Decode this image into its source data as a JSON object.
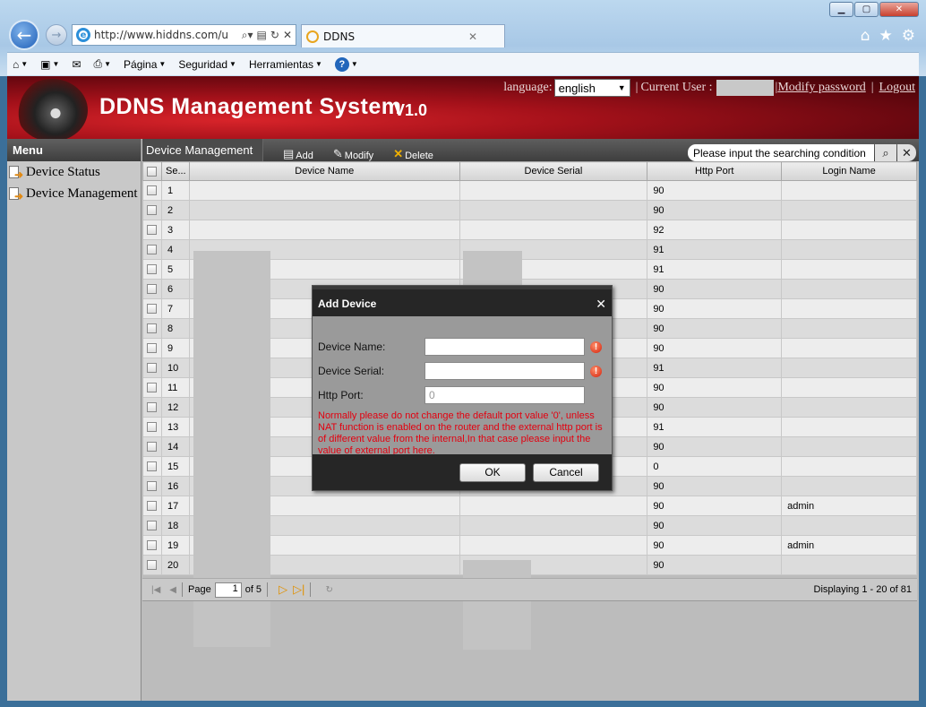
{
  "browser": {
    "url": "http://www.hiddns.com/u",
    "tab_title": "DDNS",
    "menu": [
      "Página",
      "Seguridad",
      "Herramientas"
    ]
  },
  "banner": {
    "title": "DDNS Management System",
    "version": "V1.0",
    "language_label": "language:",
    "language_value": "english",
    "current_user_label": "Current User :",
    "modify_password": "Modify password",
    "logout": "Logout"
  },
  "sidebar": {
    "header": "Menu",
    "items": [
      {
        "label": "Device Status"
      },
      {
        "label": "Device Management"
      }
    ]
  },
  "toolbar": {
    "title": "Device Management",
    "add": "Add",
    "modify": "Modify",
    "delete": "Delete",
    "search_placeholder": "Please input the searching condition"
  },
  "grid": {
    "columns": [
      "Se...",
      "Device Name",
      "Device Serial",
      "Http Port",
      "Login Name"
    ],
    "rows": [
      {
        "seq": "1",
        "port": "90",
        "login": ""
      },
      {
        "seq": "2",
        "port": "90",
        "login": ""
      },
      {
        "seq": "3",
        "port": "92",
        "login": ""
      },
      {
        "seq": "4",
        "port": "91",
        "login": ""
      },
      {
        "seq": "5",
        "port": "91",
        "login": ""
      },
      {
        "seq": "6",
        "port": "90",
        "login": ""
      },
      {
        "seq": "7",
        "port": "90",
        "login": ""
      },
      {
        "seq": "8",
        "port": "90",
        "login": ""
      },
      {
        "seq": "9",
        "port": "90",
        "login": ""
      },
      {
        "seq": "10",
        "port": "91",
        "login": ""
      },
      {
        "seq": "11",
        "port": "90",
        "login": ""
      },
      {
        "seq": "12",
        "port": "90",
        "login": ""
      },
      {
        "seq": "13",
        "port": "91",
        "login": ""
      },
      {
        "seq": "14",
        "port": "90",
        "login": ""
      },
      {
        "seq": "15",
        "port": "0",
        "login": ""
      },
      {
        "seq": "16",
        "port": "90",
        "login": ""
      },
      {
        "seq": "17",
        "port": "90",
        "login": "admin"
      },
      {
        "seq": "18",
        "port": "90",
        "login": ""
      },
      {
        "seq": "19",
        "port": "90",
        "login": "admin"
      },
      {
        "seq": "20",
        "port": "90",
        "login": ""
      }
    ]
  },
  "pager": {
    "page_label": "Page",
    "page_value": "1",
    "of_label": "of 5",
    "displaying": "Displaying 1 - 20 of 81"
  },
  "dialog": {
    "title": "Add Device",
    "device_name_label": "Device Name:",
    "device_serial_label": "Device Serial:",
    "http_port_label": "Http Port:",
    "http_port_value": "0",
    "note": "Normally please do not change the default port value '0', unless NAT function is enabled on the router and the external http port is of different value from the internal,In that case please input the value of external port here.",
    "ok": "OK",
    "cancel": "Cancel"
  }
}
